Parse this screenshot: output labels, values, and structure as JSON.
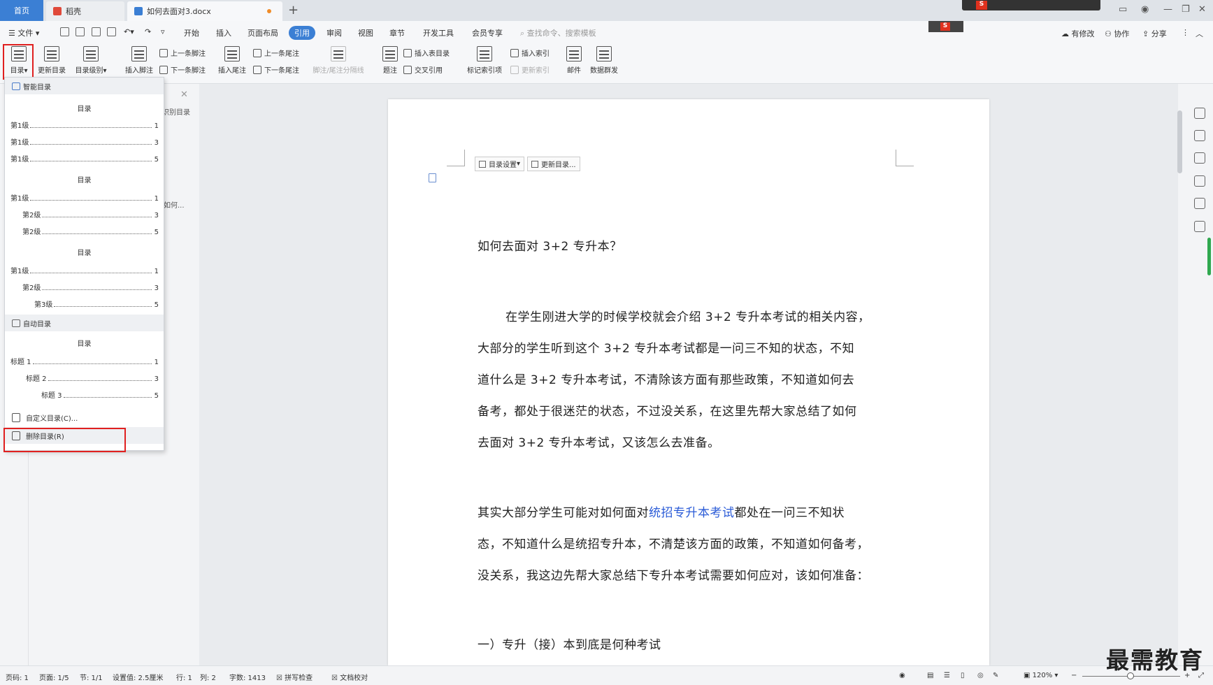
{
  "tabs": {
    "home": "首页",
    "daoke": "稻壳",
    "doc": "如何去面对3.docx",
    "new": "+"
  },
  "menu": {
    "file": "文件",
    "items": [
      "开始",
      "插入",
      "页面布局",
      "引用",
      "审阅",
      "视图",
      "章节",
      "开发工具",
      "会员专享"
    ],
    "active_index": 3,
    "search_placeholder": "查找命令、搜索模板",
    "right": {
      "revise": "有修改",
      "collab": "协作",
      "share": "分享"
    }
  },
  "ribbon": {
    "toc": "目录",
    "update_toc": "更新目录",
    "toc_level": "目录级别",
    "insert_footnote": "插入脚注",
    "prev_footnote": "上一条脚注",
    "next_footnote": "下一条脚注",
    "insert_endnote": "插入尾注",
    "prev_endnote": "上一条尾注",
    "next_endnote": "下一条尾注",
    "footnote_sep": "脚注/尾注分隔线",
    "caption": "题注",
    "insert_table_toc": "插入表目录",
    "cross_ref": "交叉引用",
    "mark_index": "标记索引项",
    "insert_index": "插入索引",
    "update_index": "更新索引",
    "mail": "邮件",
    "data_mass": "数据群发"
  },
  "leftpanel": {
    "label1": "识别目录",
    "label2": "如何..."
  },
  "dropdown": {
    "smart_toc": "智能目录",
    "auto_toc": "自动目录",
    "previews": [
      {
        "title": "目录",
        "lines": [
          {
            "label": "第1级",
            "num": "1",
            "indent": 0
          },
          {
            "label": "第1级",
            "num": "3",
            "indent": 0
          },
          {
            "label": "第1级",
            "num": "5",
            "indent": 0
          }
        ]
      },
      {
        "title": "目录",
        "lines": [
          {
            "label": "第1级",
            "num": "1",
            "indent": 0
          },
          {
            "label": "第2级",
            "num": "3",
            "indent": 1
          },
          {
            "label": "第2级",
            "num": "5",
            "indent": 1
          }
        ]
      },
      {
        "title": "目录",
        "lines": [
          {
            "label": "第1级",
            "num": "1",
            "indent": 0
          },
          {
            "label": "第2级",
            "num": "3",
            "indent": 1
          },
          {
            "label": "第3级",
            "num": "5",
            "indent": 2
          }
        ]
      }
    ],
    "auto_preview": {
      "title": "目录",
      "lines": [
        {
          "label": "标题 1",
          "num": "1",
          "indent": 0
        },
        {
          "label": "标题 2",
          "num": "3",
          "indent": 1
        },
        {
          "label": "标题 3",
          "num": "5",
          "indent": 2
        }
      ]
    },
    "custom_toc": "自定义目录(C)...",
    "delete_toc": "删除目录(R)"
  },
  "page": {
    "toc_settings": "目录设置",
    "update_toc": "更新目录...",
    "heading": "如何去面对 3+2 专升本？",
    "p1": [
      "在学生刚进大学的时候学校就会介绍 3+2 专升本考试的相关内容，",
      "大部分的学生听到这个 3+2 专升本考试都是一问三不知的状态，不知",
      "道什么是 3+2 专升本考试，不清除该方面有那些政策，不知道如何去",
      "备考，都处于很迷茫的状态，不过没关系，在这里先帮大家总结了如何",
      "去面对 3+2 专升本考试，又该怎么去准备。"
    ],
    "p2_prefix": "其实大部分学生可能对如何面对",
    "p2_link": "统招专升本考试",
    "p2_suffix": "都处在一问三不知状",
    "p2_rest": [
      "态，不知道什么是统招专升本，不清楚该方面的政策，不知道如何备考，",
      "没关系，我这边先帮大家总结下专升本考试需要如何应对，该如何准备："
    ],
    "section1": "一）专升（接）本到底是何种考试"
  },
  "status": {
    "page": "页码: 1",
    "pages": "页面: 1/5",
    "section": "节: 1/1",
    "setting": "设置值: 2.5厘米",
    "row": "行: 1",
    "col": "列: 2",
    "words": "字数: 1413",
    "spell": "拼写检查",
    "proof": "文档校对",
    "zoom": "120%"
  },
  "watermark": "最需教育",
  "colors": {
    "accent": "#3b7fd4",
    "highlight": "#e02020",
    "link": "#2a5bd7"
  }
}
